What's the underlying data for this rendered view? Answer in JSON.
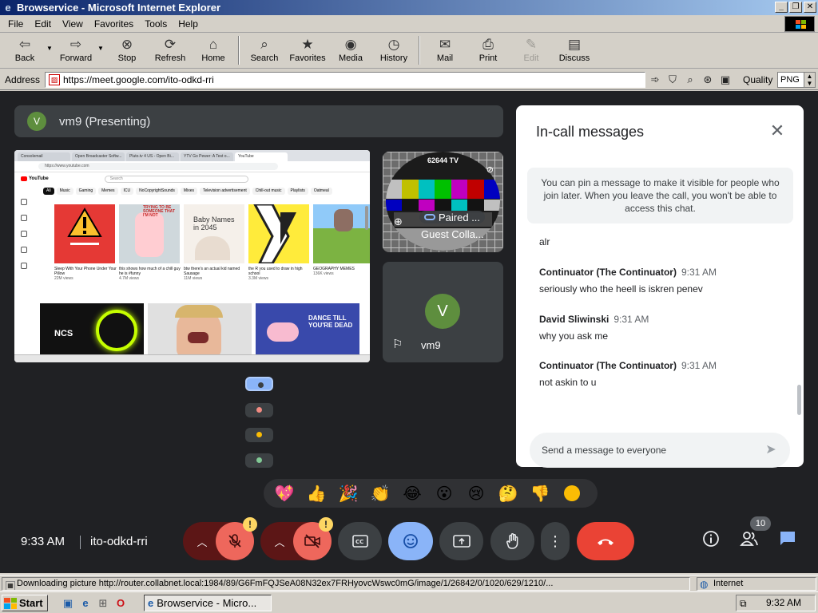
{
  "window": {
    "title": "Browservice - Microsoft Internet Explorer",
    "buttons": [
      "minimize",
      "maximize",
      "close"
    ]
  },
  "menu": [
    "File",
    "Edit",
    "View",
    "Favorites",
    "Tools",
    "Help"
  ],
  "toolbar": [
    {
      "label": "Back",
      "icon": "back-arrow-icon"
    },
    {
      "label": "Forward",
      "icon": "forward-arrow-icon"
    },
    {
      "label": "Stop",
      "icon": "stop-icon"
    },
    {
      "label": "Refresh",
      "icon": "refresh-icon"
    },
    {
      "label": "Home",
      "icon": "home-icon"
    },
    {
      "label": "Search",
      "icon": "search-icon"
    },
    {
      "label": "Favorites",
      "icon": "favorites-icon"
    },
    {
      "label": "Media",
      "icon": "media-icon"
    },
    {
      "label": "History",
      "icon": "history-icon"
    },
    {
      "label": "Mail",
      "icon": "mail-icon"
    },
    {
      "label": "Print",
      "icon": "print-icon"
    },
    {
      "label": "Edit",
      "icon": "edit-icon",
      "disabled": true
    },
    {
      "label": "Discuss",
      "icon": "discuss-icon"
    }
  ],
  "address": {
    "label": "Address",
    "url": "https://meet.google.com/ito-odkd-rri",
    "quality_label": "Quality",
    "quality_value": "PNG"
  },
  "meet": {
    "presenter": {
      "initial": "V",
      "label": "vm9 (Presenting)"
    },
    "screenshare": {
      "tabs": [
        "Consolemail",
        "Open Broadcaster Softw...",
        "Pluto.tv 4 US - Open Bi...",
        "YTV Go Pewer: A Test o...",
        "YouTube"
      ],
      "url": "https://www.youtube.com",
      "search_placeholder": "Search",
      "chips": [
        "All",
        "Music",
        "Gaming",
        "Memes",
        "ICU",
        "NoCopyrightSounds",
        "Mixes",
        "Television advertisement",
        "Chill-out music",
        "Playlists",
        "Oatmeal"
      ],
      "videos": [
        {
          "title": "Sleep With Your Phone Under Your Pillow",
          "meta": "22M views"
        },
        {
          "title": "this shows how much of a chill guy he is #funny",
          "meta": "4.7M views"
        },
        {
          "title": "btw there's an actual kid named Sausage",
          "meta": "11M views"
        },
        {
          "title": "the R you used to draw in high school",
          "meta": "3.3M views"
        },
        {
          "title": "GEOGRAPHY MEMES",
          "meta": "136K views"
        }
      ],
      "thumb_texts": [
        "Baby Names in 2045",
        "TRYING TO BE SOMEONE THAT I'M NOT",
        "NCS",
        "DANCE TILL YOU'RE DEAD"
      ]
    },
    "tiles": {
      "guest": {
        "card_label": "62644 TV",
        "chip": "Paired ...",
        "name": "Guest Colla..."
      },
      "vm9": {
        "initial": "V",
        "name": "vm9"
      }
    },
    "filmstrip_colors": [
      "#8ab4f8",
      "#f28b82",
      "#fbbc04",
      "#81c995"
    ],
    "chat": {
      "title": "In-call messages",
      "note": "You can pin a message to make it visible for people who join later. When you leave the call, you won't be able to access this chat.",
      "messages": [
        {
          "text": "alr"
        },
        {
          "sender": "Continuator (The Continuator)",
          "time": "9:31 AM",
          "text": "seriously who the heell is iskren penev"
        },
        {
          "sender": "David Sliwinski",
          "time": "9:31 AM",
          "text": "why you ask me"
        },
        {
          "sender": "Continuator (The Continuator)",
          "time": "9:31 AM",
          "text": "not askin to u"
        }
      ],
      "input_placeholder": "Send a message to everyone"
    },
    "reactions": [
      "💖",
      "👍",
      "🎉",
      "👏",
      "😂",
      "😮",
      "😢",
      "🤔",
      "👎"
    ],
    "controls": {
      "time": "9:33 AM",
      "meeting_code": "ito-odkd-rri",
      "participant_count": "10"
    }
  },
  "status": {
    "text": "Downloading picture http://router.collabnet.local:1984/89/G6FmFQJSeA08N32ex7FRHyovcWswc0mG/image/1/26842/0/1020/629/1210/...",
    "zone": "Internet"
  },
  "taskbar": {
    "start": "Start",
    "task": "Browservice - Micro...",
    "clock": "9:32 AM"
  }
}
